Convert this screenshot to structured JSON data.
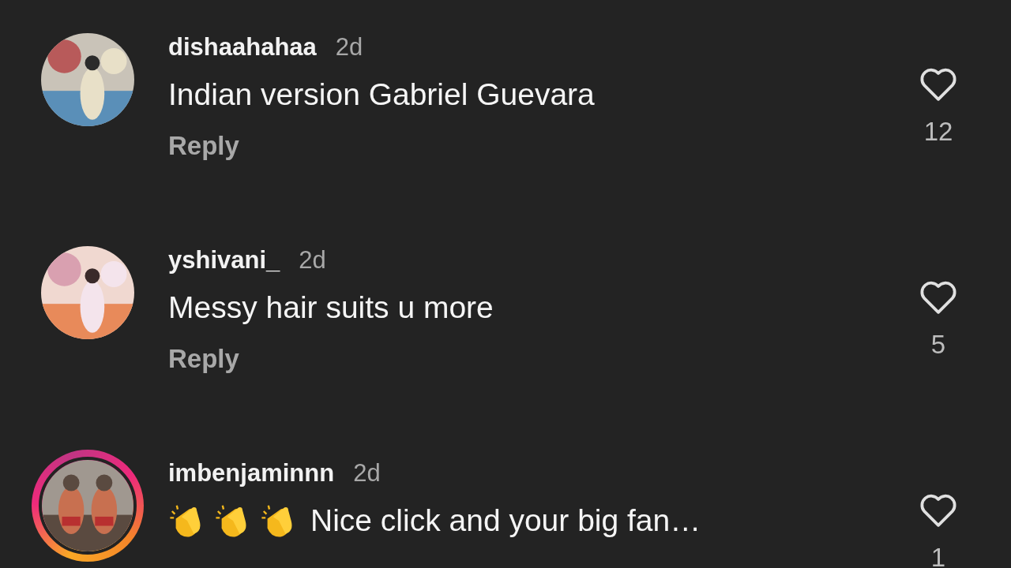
{
  "comments": [
    {
      "username": "dishaahahaa",
      "time": "2d",
      "text": "Indian version Gabriel Guevara",
      "reply": "Reply",
      "likes": "12",
      "liked": false,
      "story_ring": false
    },
    {
      "username": "yshivani_",
      "time": "2d",
      "text": "Messy hair suits u more",
      "reply": "Reply",
      "likes": "5",
      "liked": false,
      "story_ring": false
    },
    {
      "username": "imbenjaminnn",
      "time": "2d",
      "text": "Nice click and your big fan…",
      "likes": "1",
      "liked": false,
      "story_ring": true,
      "emojis": [
        {
          "kind": "clap"
        },
        {
          "kind": "clap"
        },
        {
          "kind": "clap"
        }
      ]
    }
  ]
}
